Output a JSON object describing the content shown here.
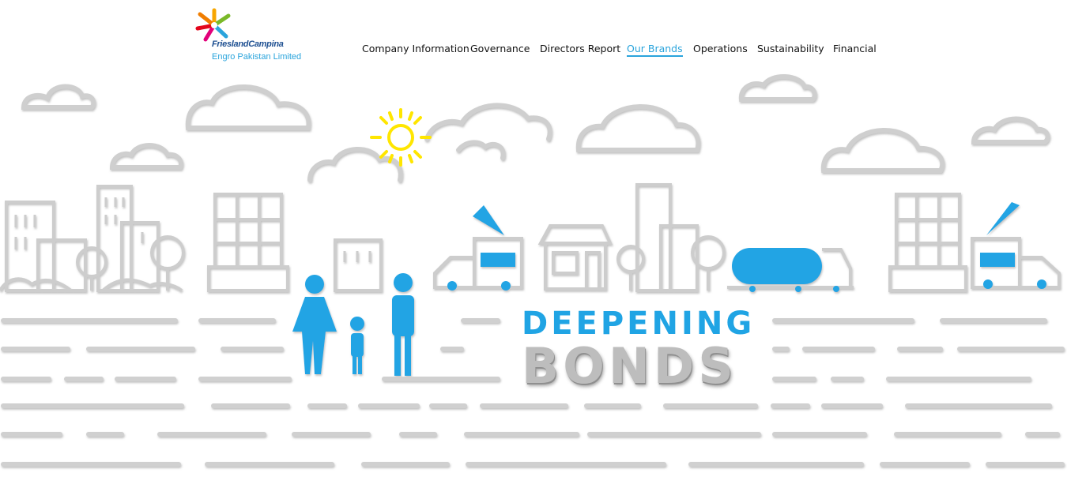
{
  "logo": {
    "brand": "FrieslandCampina",
    "subtitle": "Engro Pakistan Limited"
  },
  "nav": {
    "items": [
      {
        "label": "Company Information"
      },
      {
        "label": "Governance"
      },
      {
        "label": "Directors Report"
      },
      {
        "label": "Our Brands",
        "active": true
      },
      {
        "label": "Operations"
      },
      {
        "label": "Sustainability"
      },
      {
        "label": "Financial"
      }
    ]
  },
  "hero": {
    "line1": "DEEPENING",
    "line2": "BONDS"
  },
  "colors": {
    "accent": "#2aa4dc",
    "outline": "#c9c9c9",
    "sun": "#ffe600",
    "nav_text": "#111111"
  }
}
